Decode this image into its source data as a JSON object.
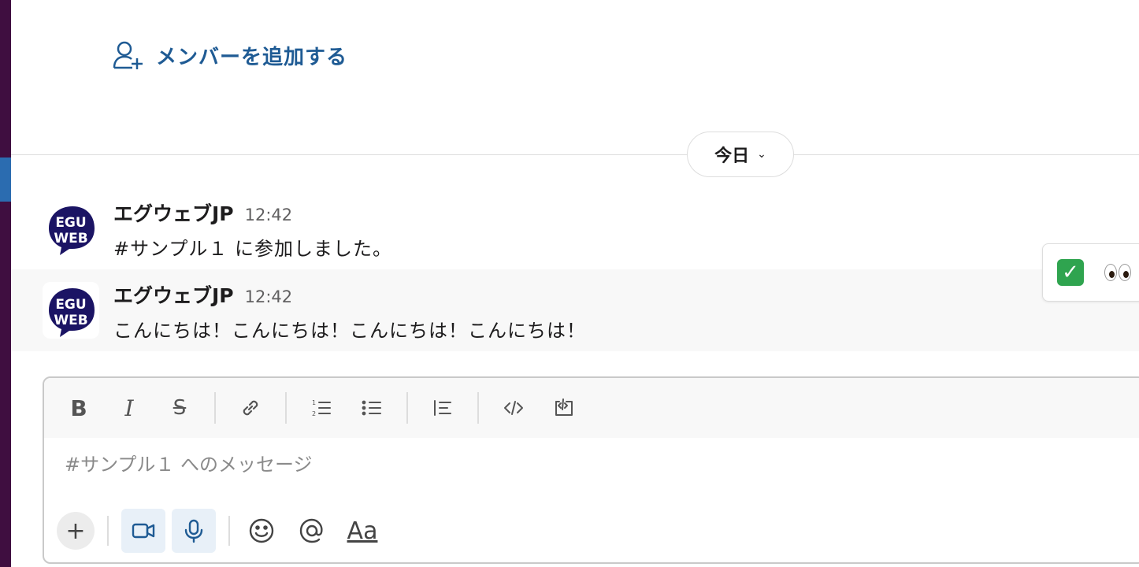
{
  "channel": {
    "add_member_label": "メンバーを追加する"
  },
  "date_divider": {
    "label": "今日",
    "chevron": "⌄"
  },
  "messages": [
    {
      "author": "エグウェブJP",
      "time": "12:42",
      "text": "#サンプル１ に参加しました。",
      "avatar_text_line1": "EGU",
      "avatar_text_line2": "WEB"
    },
    {
      "author": "エグウェブJP",
      "time": "12:42",
      "text": "こんにちは！こんにちは！こんにちは！こんにちは！",
      "avatar_text_line1": "EGU",
      "avatar_text_line2": "WEB"
    }
  ],
  "reactions": {
    "check_glyph": "✓",
    "items": [
      "white-check-mark-icon",
      "eyes-icon"
    ]
  },
  "composer": {
    "placeholder": "#サンプル１ へのメッセージ",
    "toolbar": {
      "bold": "B",
      "italic": "I",
      "strike": "S"
    },
    "plus": "+",
    "format_label": "Aa"
  },
  "colors": {
    "sidebar": "#3f0e40",
    "link_blue": "#1f5b94",
    "avatar_navy": "#1b1464",
    "check_green": "#2fa44f"
  }
}
